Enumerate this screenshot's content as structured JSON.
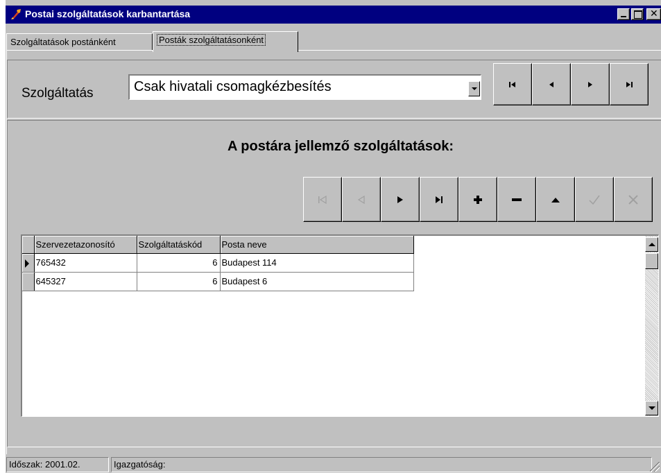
{
  "window": {
    "title": "Postai szolgáltatások karbantartása"
  },
  "tabs": [
    {
      "label": "Szolgáltatások postánként",
      "active": false
    },
    {
      "label": "Posták szolgáltatásonként",
      "active": true
    }
  ],
  "filter": {
    "label": "Szolgáltatás",
    "selected": "Csak hivatali csomagkézbesítés"
  },
  "nav_top": {
    "icons": [
      "first-record-icon",
      "prior-record-icon",
      "next-record-icon",
      "last-record-icon"
    ]
  },
  "section": {
    "heading": "A postára jellemző szolgáltatások:"
  },
  "nav_grid": {
    "icons": [
      "first-icon",
      "prior-icon",
      "next-icon",
      "last-icon",
      "insert-icon",
      "delete-icon",
      "edit-icon",
      "post-icon",
      "cancel-icon"
    ],
    "enabled": [
      false,
      false,
      true,
      true,
      true,
      true,
      true,
      false,
      false
    ]
  },
  "grid": {
    "columns": [
      "Szervezetazonosító",
      "Szolgáltatáskód",
      "Posta neve"
    ],
    "rows": [
      {
        "org_id": "765432",
        "service_code": "6",
        "post_name": "Budapest 114",
        "current": true
      },
      {
        "org_id": "645327",
        "service_code": "6",
        "post_name": "Budapest 6",
        "current": false
      }
    ]
  },
  "status": {
    "period": "Időszak: 2001.02.",
    "directorate": "Igazgatóság:"
  },
  "colors": {
    "titlebar": "#000080",
    "face": "#c0c0c0",
    "shadow": "#808080",
    "highlight": "#ffffff",
    "disabled_glyph": "#a0a0a0"
  }
}
